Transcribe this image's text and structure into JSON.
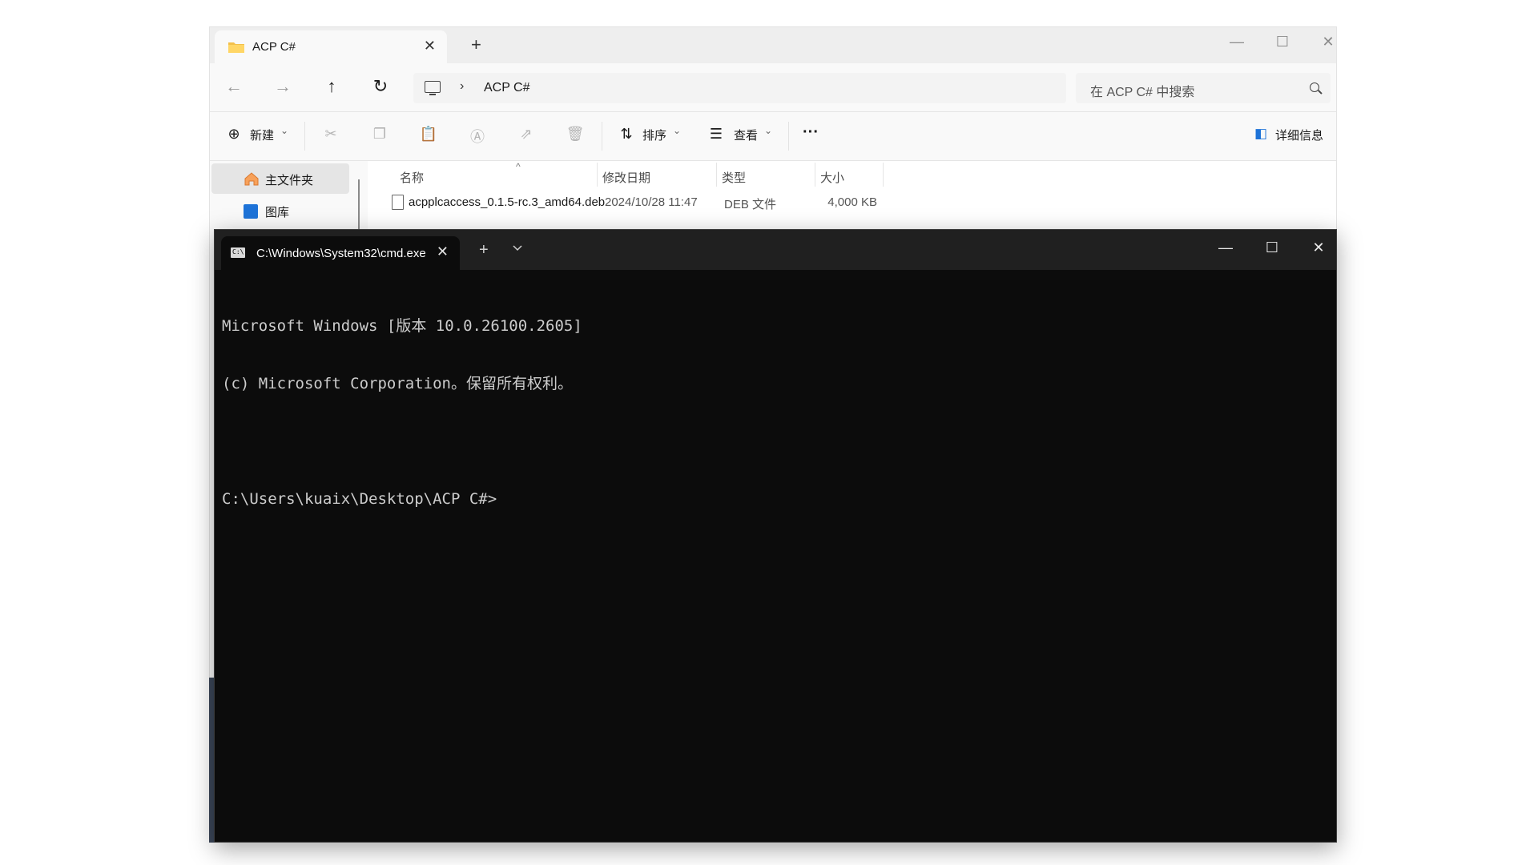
{
  "explorer": {
    "tab_title": "ACP C#",
    "tab_close": "✕",
    "new_tab": "+",
    "window_controls": {
      "minimize": "—",
      "maximize": "☐",
      "close": "✕"
    },
    "nav": {
      "back": "←",
      "forward": "→",
      "up": "↑",
      "refresh": "↻",
      "breadcrumb_sep": "›"
    },
    "address_crumb": "ACP C#",
    "search_placeholder": "在 ACP C# 中搜索",
    "toolbar": {
      "new_label": "新建",
      "sort_label": "排序",
      "view_label": "查看",
      "more_label": "···",
      "details_label": "详细信息",
      "dropdown_caret": "⌄"
    },
    "sidebar": {
      "items": [
        {
          "label": "主文件夹",
          "icon": "home-icon",
          "active": true
        },
        {
          "label": "图库",
          "icon": "gallery-icon",
          "active": false
        }
      ]
    },
    "list": {
      "columns": [
        "名称",
        "修改日期",
        "类型",
        "大小"
      ],
      "sort_indicator": "^",
      "rows": [
        {
          "name": "acpplcaccess_0.1.5-rc.3_amd64.deb",
          "modified": "2024/10/28 11:47",
          "type": "DEB 文件",
          "size": "4,000 KB"
        }
      ]
    }
  },
  "terminal": {
    "tab_title": "C:\\Windows\\System32\\cmd.exe",
    "tab_close": "✕",
    "new_tab": "+",
    "window_controls": {
      "minimize": "—",
      "maximize": "☐",
      "close": "✕"
    },
    "lines": [
      "Microsoft Windows [版本 10.0.26100.2605]",
      "(c) Microsoft Corporation。保留所有权利。",
      "",
      "C:\\Users\\kuaix\\Desktop\\ACP C#>"
    ]
  },
  "colors": {
    "terminal_bg": "#0c0c0c",
    "terminal_text": "#cccccc",
    "accent": "#1e73d8",
    "folder": "#f3c04b"
  }
}
